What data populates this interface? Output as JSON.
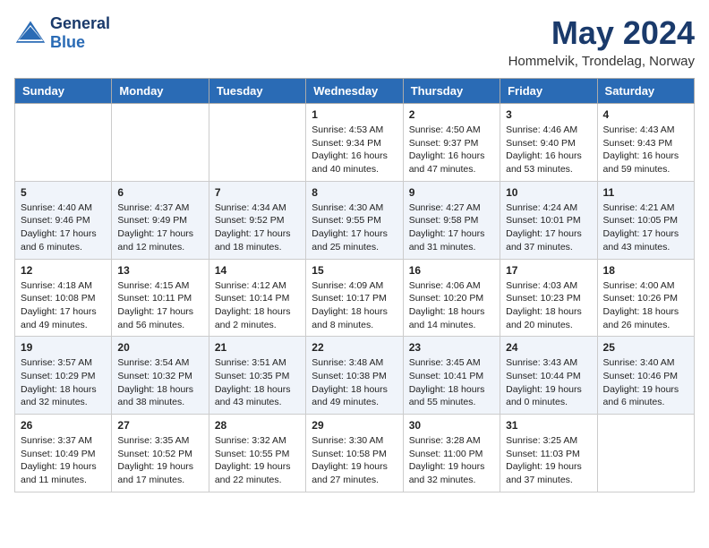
{
  "header": {
    "logo_line1": "General",
    "logo_line2": "Blue",
    "title": "May 2024",
    "subtitle": "Hommelvik, Trondelag, Norway"
  },
  "days_of_week": [
    "Sunday",
    "Monday",
    "Tuesday",
    "Wednesday",
    "Thursday",
    "Friday",
    "Saturday"
  ],
  "weeks": [
    [
      {
        "day": "",
        "info": ""
      },
      {
        "day": "",
        "info": ""
      },
      {
        "day": "",
        "info": ""
      },
      {
        "day": "1",
        "info": "Sunrise: 4:53 AM\nSunset: 9:34 PM\nDaylight: 16 hours\nand 40 minutes."
      },
      {
        "day": "2",
        "info": "Sunrise: 4:50 AM\nSunset: 9:37 PM\nDaylight: 16 hours\nand 47 minutes."
      },
      {
        "day": "3",
        "info": "Sunrise: 4:46 AM\nSunset: 9:40 PM\nDaylight: 16 hours\nand 53 minutes."
      },
      {
        "day": "4",
        "info": "Sunrise: 4:43 AM\nSunset: 9:43 PM\nDaylight: 16 hours\nand 59 minutes."
      }
    ],
    [
      {
        "day": "5",
        "info": "Sunrise: 4:40 AM\nSunset: 9:46 PM\nDaylight: 17 hours\nand 6 minutes."
      },
      {
        "day": "6",
        "info": "Sunrise: 4:37 AM\nSunset: 9:49 PM\nDaylight: 17 hours\nand 12 minutes."
      },
      {
        "day": "7",
        "info": "Sunrise: 4:34 AM\nSunset: 9:52 PM\nDaylight: 17 hours\nand 18 minutes."
      },
      {
        "day": "8",
        "info": "Sunrise: 4:30 AM\nSunset: 9:55 PM\nDaylight: 17 hours\nand 25 minutes."
      },
      {
        "day": "9",
        "info": "Sunrise: 4:27 AM\nSunset: 9:58 PM\nDaylight: 17 hours\nand 31 minutes."
      },
      {
        "day": "10",
        "info": "Sunrise: 4:24 AM\nSunset: 10:01 PM\nDaylight: 17 hours\nand 37 minutes."
      },
      {
        "day": "11",
        "info": "Sunrise: 4:21 AM\nSunset: 10:05 PM\nDaylight: 17 hours\nand 43 minutes."
      }
    ],
    [
      {
        "day": "12",
        "info": "Sunrise: 4:18 AM\nSunset: 10:08 PM\nDaylight: 17 hours\nand 49 minutes."
      },
      {
        "day": "13",
        "info": "Sunrise: 4:15 AM\nSunset: 10:11 PM\nDaylight: 17 hours\nand 56 minutes."
      },
      {
        "day": "14",
        "info": "Sunrise: 4:12 AM\nSunset: 10:14 PM\nDaylight: 18 hours\nand 2 minutes."
      },
      {
        "day": "15",
        "info": "Sunrise: 4:09 AM\nSunset: 10:17 PM\nDaylight: 18 hours\nand 8 minutes."
      },
      {
        "day": "16",
        "info": "Sunrise: 4:06 AM\nSunset: 10:20 PM\nDaylight: 18 hours\nand 14 minutes."
      },
      {
        "day": "17",
        "info": "Sunrise: 4:03 AM\nSunset: 10:23 PM\nDaylight: 18 hours\nand 20 minutes."
      },
      {
        "day": "18",
        "info": "Sunrise: 4:00 AM\nSunset: 10:26 PM\nDaylight: 18 hours\nand 26 minutes."
      }
    ],
    [
      {
        "day": "19",
        "info": "Sunrise: 3:57 AM\nSunset: 10:29 PM\nDaylight: 18 hours\nand 32 minutes."
      },
      {
        "day": "20",
        "info": "Sunrise: 3:54 AM\nSunset: 10:32 PM\nDaylight: 18 hours\nand 38 minutes."
      },
      {
        "day": "21",
        "info": "Sunrise: 3:51 AM\nSunset: 10:35 PM\nDaylight: 18 hours\nand 43 minutes."
      },
      {
        "day": "22",
        "info": "Sunrise: 3:48 AM\nSunset: 10:38 PM\nDaylight: 18 hours\nand 49 minutes."
      },
      {
        "day": "23",
        "info": "Sunrise: 3:45 AM\nSunset: 10:41 PM\nDaylight: 18 hours\nand 55 minutes."
      },
      {
        "day": "24",
        "info": "Sunrise: 3:43 AM\nSunset: 10:44 PM\nDaylight: 19 hours\nand 0 minutes."
      },
      {
        "day": "25",
        "info": "Sunrise: 3:40 AM\nSunset: 10:46 PM\nDaylight: 19 hours\nand 6 minutes."
      }
    ],
    [
      {
        "day": "26",
        "info": "Sunrise: 3:37 AM\nSunset: 10:49 PM\nDaylight: 19 hours\nand 11 minutes."
      },
      {
        "day": "27",
        "info": "Sunrise: 3:35 AM\nSunset: 10:52 PM\nDaylight: 19 hours\nand 17 minutes."
      },
      {
        "day": "28",
        "info": "Sunrise: 3:32 AM\nSunset: 10:55 PM\nDaylight: 19 hours\nand 22 minutes."
      },
      {
        "day": "29",
        "info": "Sunrise: 3:30 AM\nSunset: 10:58 PM\nDaylight: 19 hours\nand 27 minutes."
      },
      {
        "day": "30",
        "info": "Sunrise: 3:28 AM\nSunset: 11:00 PM\nDaylight: 19 hours\nand 32 minutes."
      },
      {
        "day": "31",
        "info": "Sunrise: 3:25 AM\nSunset: 11:03 PM\nDaylight: 19 hours\nand 37 minutes."
      },
      {
        "day": "",
        "info": ""
      }
    ]
  ]
}
